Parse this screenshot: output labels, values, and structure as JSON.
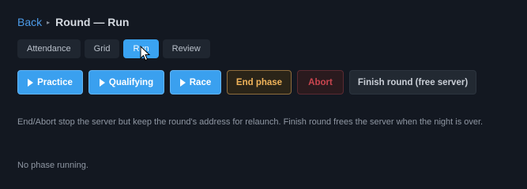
{
  "breadcrumb": {
    "back_label": "Back",
    "separator": "▸",
    "title": "Round — Run"
  },
  "tabs": [
    {
      "label": "Attendance",
      "active": false
    },
    {
      "label": "Grid",
      "active": false
    },
    {
      "label": "Run",
      "active": true
    },
    {
      "label": "Review",
      "active": false
    }
  ],
  "actions": {
    "practice_label": "Practice",
    "qualifying_label": "Qualifying",
    "race_label": "Race",
    "end_phase_label": "End phase",
    "abort_label": "Abort",
    "finish_round_label": "Finish round (free server)"
  },
  "note": "End/Abort stop the server but keep the round's address for relaunch. Finish round frees the server when the night is over.",
  "status": "No phase running.",
  "colors": {
    "background": "#131821",
    "accent": "#3aa0ef",
    "warn": "#f0b35a",
    "danger": "#c9454f"
  }
}
